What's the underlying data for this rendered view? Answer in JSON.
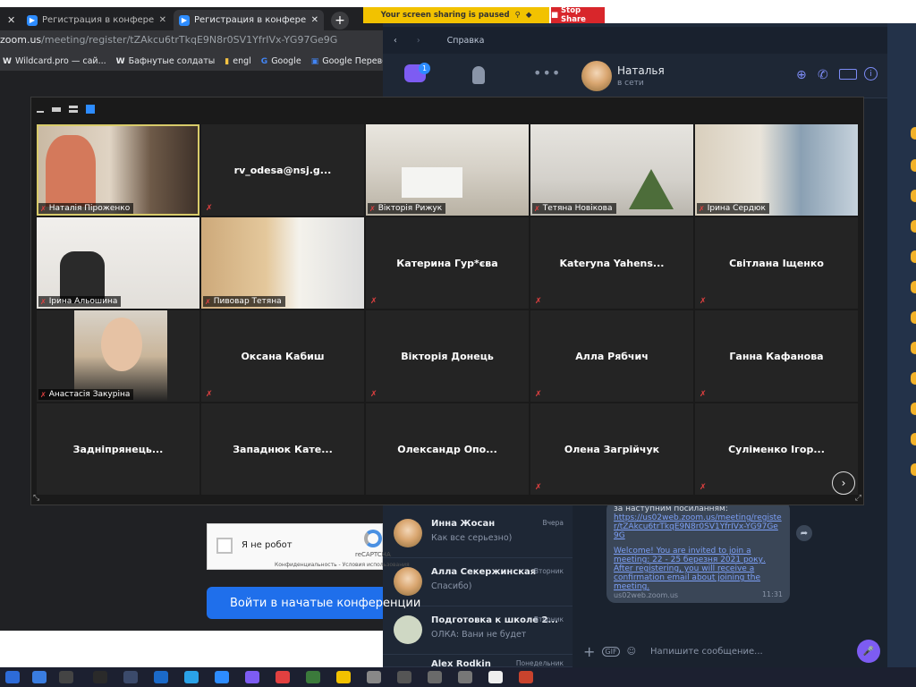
{
  "browser": {
    "tabs": [
      {
        "label": "Регистрация в конференции - Z"
      },
      {
        "label": "Регистрация в конференции - Z"
      }
    ],
    "url_host": "zoom.us",
    "url_path": "/meeting/register/tZAkcu6trTkqE9N8r0SV1YfrIVx-YG97Ge9G",
    "bookmarks": [
      "Wildcard.pro — сай...",
      "Бафнутые солдаты",
      "engl",
      "Google",
      "Google Переводчик"
    ]
  },
  "sharing": {
    "status": "Your screen sharing is paused",
    "stop_label": "Stop Share"
  },
  "viber": {
    "menu_help": "Справка",
    "badge": "1",
    "contact": {
      "name": "Наталья",
      "status": "в сети"
    },
    "chats": [
      {
        "name": "Инна Жосан",
        "message": "Как все серьезно)",
        "time": "Вчера"
      },
      {
        "name": "Алла Секержинская",
        "message": "Спасибо)",
        "time": "Вторник"
      },
      {
        "name": "Подготовка к школе 2...",
        "message": "ОЛКА: Вани не будет",
        "time": "Вторник"
      },
      {
        "name": "Alex Rodkin",
        "message": "",
        "time": "Понедельник"
      }
    ],
    "bubble": {
      "line1": "за наступним посиланням:",
      "link": "https://us02web.zoom.us/meeting/register/tZAkcu6trTkqE9N8r0SV1YfrIVx-YG97Ge9G",
      "welcome": "Welcome! You are invited to join a meeting: 22 - 25 березня 2021 року. After registering, you will receive a confirmation email about joining the meeting.",
      "domain": "us02web.zoom.us",
      "time": "11:31"
    },
    "composer_placeholder": "Напишите сообщение..."
  },
  "gallery": {
    "video_tiles": [
      {
        "name": "Наталія Піроженко"
      },
      {
        "name": "Вікторія Рижук"
      },
      {
        "name": "Тетяна Новікова"
      },
      {
        "name": "Ірина Сердюк"
      },
      {
        "name": "Ірина Альошина"
      },
      {
        "name": "Пивовар Тетяна"
      },
      {
        "name": "Анастасія Закуріна"
      }
    ],
    "name_tiles": [
      "rv_odesa@nsj.g...",
      "Катерина Гур*єва",
      "Kateryna  Yahens...",
      "Світлана Іщенко",
      "Оксана Кабиш",
      "Вікторія Донець",
      "Алла Рябчич",
      "Ганна Кафанова",
      "Задніпрянець...",
      "Западнюк  Кате...",
      "Олександр  Опо...",
      "Олена Загрійчук",
      "Суліменко Ігор..."
    ]
  },
  "register_page": {
    "captcha_label": "Я не робот",
    "captcha_brand": "reCAPTCHA",
    "captcha_terms": "Конфиденциальность - Условия использования",
    "join_label": "Войти в начатые конференции"
  }
}
